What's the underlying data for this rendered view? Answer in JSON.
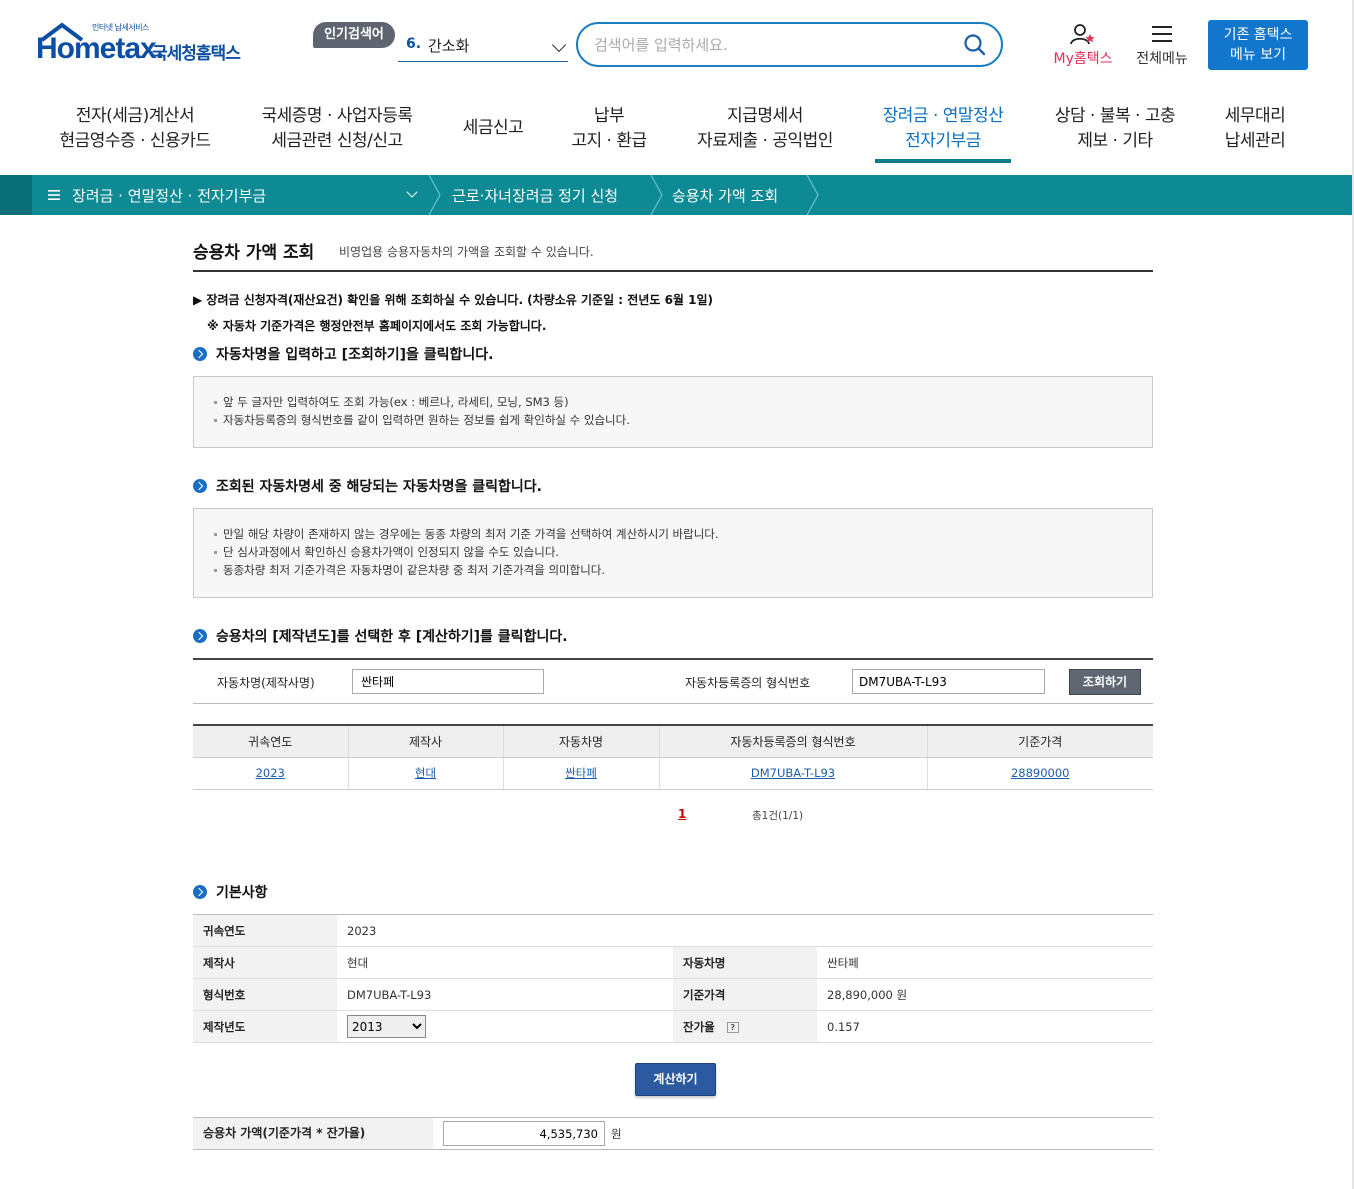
{
  "header": {
    "logo_small": "인터넷 납세서비스",
    "logo_main": "Hometax.",
    "logo_ko": "국세청홈택스",
    "popular_badge": "인기검색어",
    "popular_rank": "6.",
    "popular_word": "간소화",
    "search_placeholder": "검색어를 입력하세요.",
    "myhome_label": "My홈택스",
    "allmenu_label": "전체메뉴",
    "old_home_line1": "기존 홈택스",
    "old_home_line2": "메뉴 보기"
  },
  "gnb": [
    {
      "line1": "전자(세금)계산서",
      "line2": "현금영수증 · 신용카드"
    },
    {
      "line1": "국세증명 · 사업자등록",
      "line2": "세금관련 신청/신고"
    },
    {
      "line1": "세금신고",
      "line2": ""
    },
    {
      "line1": "납부",
      "line2": "고지 · 환급"
    },
    {
      "line1": "지급명세서",
      "line2": "자료제출 · 공익법인"
    },
    {
      "line1": "장려금 · 연말정산",
      "line2": "전자기부금"
    },
    {
      "line1": "상담 · 불복 · 고충",
      "line2": "제보 · 기타"
    },
    {
      "line1": "세무대리",
      "line2": "납세관리"
    }
  ],
  "breadcrumb": {
    "level1": "장려금 · 연말정산 · 전자기부금",
    "level2": "근로·자녀장려금 정기 신청",
    "level3": "승용차 가액 조회"
  },
  "page": {
    "title": "승용차 가액 조회",
    "desc": "비영업용 승용자동차의 가액을 조회할 수 있습니다.",
    "note1": "▶ 장려금 신청자격(재산요건) 확인을 위해 조회하실 수 있습니다. (차량소유 기준일 : 전년도 6월 1일)",
    "note2": "※ 자동차 기준가격은 행정안전부 홈페이지에서도 조회 가능합니다."
  },
  "step1": {
    "heading": "자동차명을 입력하고 [조회하기]을 클릭합니다.",
    "lines": [
      "앞 두 글자만 입력하여도 조회 가능(ex : 베르나, 라세티, 모닝, SM3 등)",
      "자동차등록증의 형식번호를 같이 입력하면 원하는 정보를 쉽게 확인하실 수 있습니다."
    ]
  },
  "step2": {
    "heading": "조회된 자동차명세 중 해당되는 자동차명을 클릭합니다.",
    "lines": [
      "만일 해당 차량이 존재하지 않는 경우에는 동종 차량의 최저 기준 가격을 선택하여 계산하시기 바랍니다.",
      "단 심사과정에서 확인하신 승용차가액이 인정되지 않을 수도 있습니다.",
      "동종차량 최저 기준가격은 자동차명이 같은차량 중  최저 기준가격을 의미합니다."
    ]
  },
  "step3": {
    "heading": "승용차의 [제작년도]를 선택한 후 [계산하기]를 클릭합니다."
  },
  "search_form": {
    "car_name_label": "자동차명(제작사명)",
    "car_name_value": "싼타페",
    "model_label": "자동차등록증의 형식번호",
    "model_value": "DM7UBA-T-L93",
    "search_button": "조회하기"
  },
  "result_table": {
    "headers": [
      "귀속연도",
      "제작사",
      "자동차명",
      "자동차등록증의 형식번호",
      "기준가격"
    ],
    "rows": [
      [
        "2023",
        "현대",
        "싼타페",
        "DM7UBA-T-L93",
        "28890000"
      ]
    ]
  },
  "pager": {
    "current": "1",
    "total": "총1건(1/1)"
  },
  "basic": {
    "heading": "기본사항",
    "year_label": "귀속연도",
    "year_value": "2023",
    "maker_label": "제작사",
    "maker_value": "현대",
    "car_label": "자동차명",
    "car_value": "싼타페",
    "model_label": "형식번호",
    "model_value": "DM7UBA-T-L93",
    "price_label": "기준가격",
    "price_value": "28,890,000 원",
    "made_year_label": "제작년도",
    "made_year_value": "2013",
    "residual_label": "잔가율",
    "residual_help": "?",
    "residual_value": "0.157"
  },
  "calc_button": "계산하기",
  "final": {
    "label": "승용차 가액(기준가격 * 잔가율)",
    "value": "4,535,730",
    "unit": "원"
  }
}
